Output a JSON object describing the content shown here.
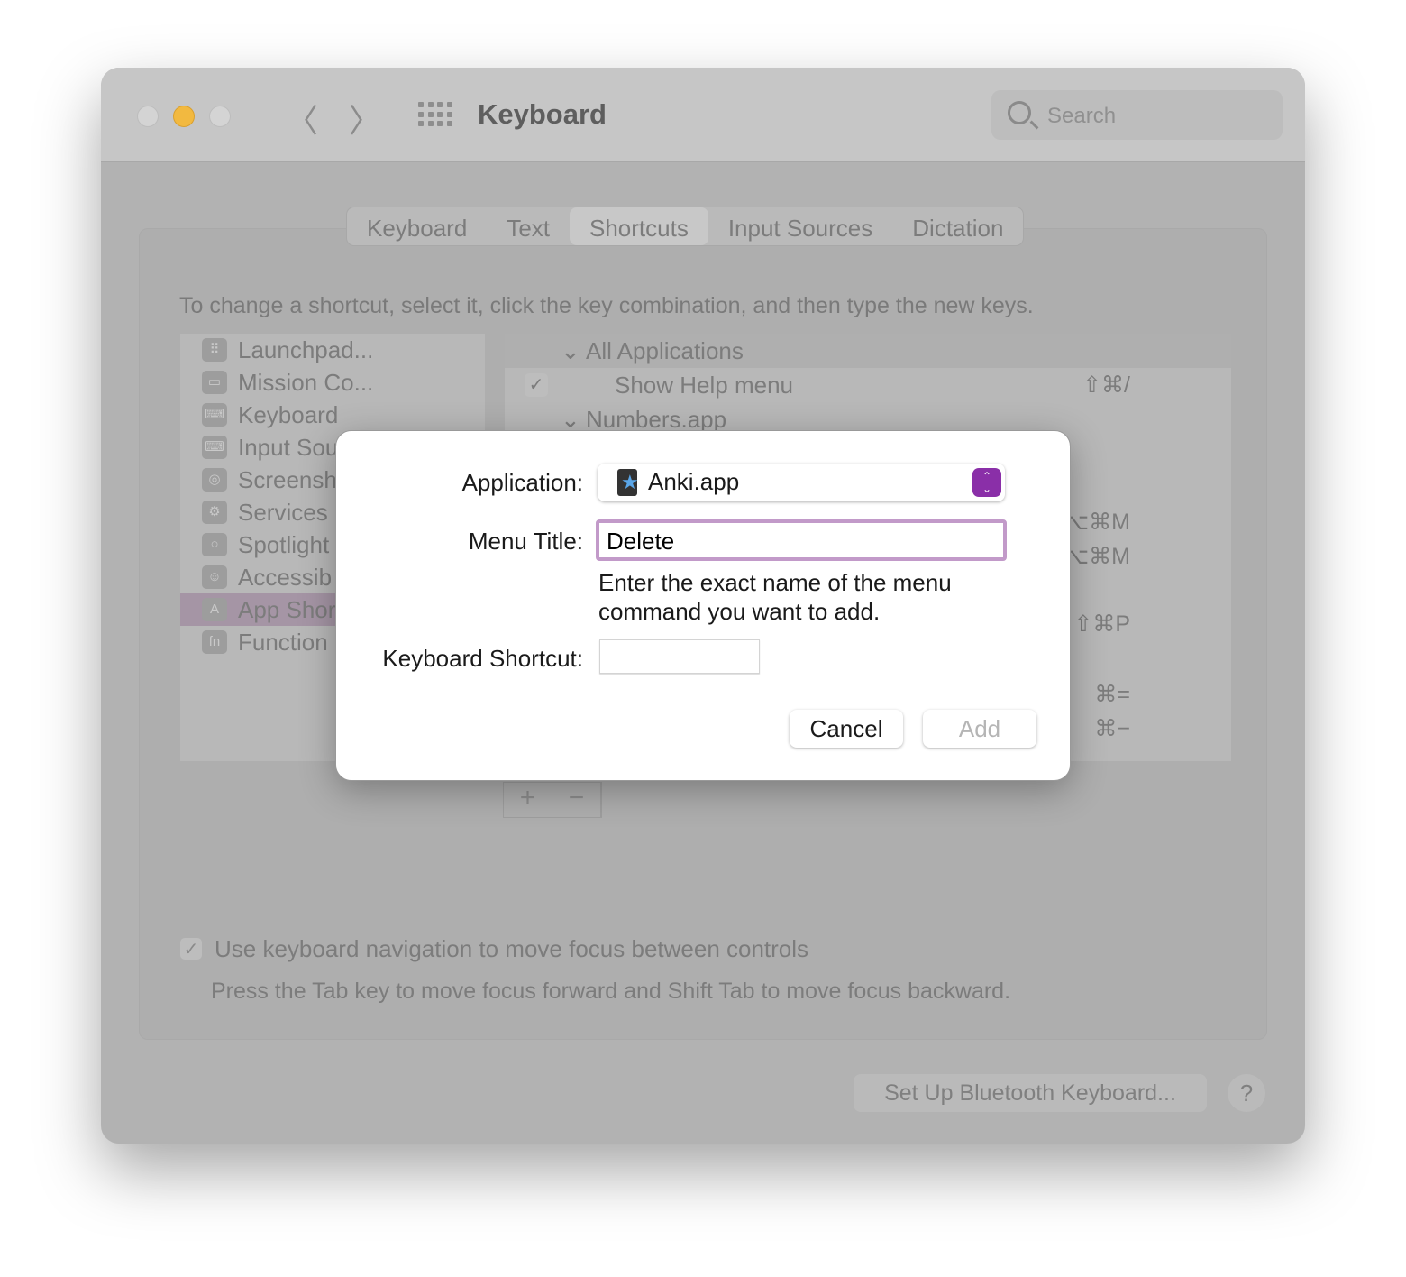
{
  "window": {
    "title": "Keyboard",
    "search_placeholder": "Search"
  },
  "tabs": [
    {
      "label": "Keyboard"
    },
    {
      "label": "Text"
    },
    {
      "label": "Shortcuts",
      "selected": true
    },
    {
      "label": "Input Sources"
    },
    {
      "label": "Dictation"
    }
  ],
  "instructions": "To change a shortcut, select it, click the key combination, and then type the new keys.",
  "sidebar": [
    {
      "label": "Launchpad...",
      "icon": "launchpad-icon",
      "glyph": "⠿"
    },
    {
      "label": "Mission Co...",
      "icon": "mission-control-icon",
      "glyph": "▭"
    },
    {
      "label": "Keyboard",
      "icon": "keyboard-icon",
      "glyph": "⌨"
    },
    {
      "label": "Input Sou",
      "icon": "input-sources-icon",
      "glyph": "⌨"
    },
    {
      "label": "Screensh",
      "icon": "screenshot-icon",
      "glyph": "◎"
    },
    {
      "label": "Services",
      "icon": "gear-icon",
      "glyph": "⚙"
    },
    {
      "label": "Spotlight",
      "icon": "magnifier-icon",
      "glyph": "○"
    },
    {
      "label": "Accessib",
      "icon": "accessibility-icon",
      "glyph": "☺"
    },
    {
      "label": "App Shor",
      "icon": "app-store-icon",
      "glyph": "A",
      "selected": true
    },
    {
      "label": "Function",
      "icon": "fn-icon",
      "glyph": "fn"
    }
  ],
  "shortcuts": [
    {
      "label": "All Applications",
      "group": true
    },
    {
      "label": "Show Help menu",
      "key": "⇧⌘/",
      "checked": true
    },
    {
      "label": "Numbers.app",
      "group": true
    }
  ],
  "hidden_keys": [
    "⌥⌘M",
    "⌥⌘M",
    "⇧⌘P",
    "⌘=",
    "⌘−"
  ],
  "controls": {
    "add": "+",
    "remove": "−"
  },
  "keyboard_nav": {
    "label": "Use keyboard navigation to move focus between controls",
    "checked": true,
    "sub": "Press the Tab key to move focus forward and Shift Tab to move focus backward."
  },
  "bluetooth_button": "Set Up Bluetooth Keyboard...",
  "help": "?",
  "dialog": {
    "app_label": "Application:",
    "app_value": "Anki.app",
    "menu_label": "Menu Title:",
    "menu_value": "Delete",
    "hint_line1": "Enter the exact name of the menu",
    "hint_line2": "command you want to add.",
    "shortcut_label": "Keyboard Shortcut:",
    "shortcut_value": "",
    "cancel": "Cancel",
    "add": "Add",
    "accent": "#8a2fa8"
  }
}
